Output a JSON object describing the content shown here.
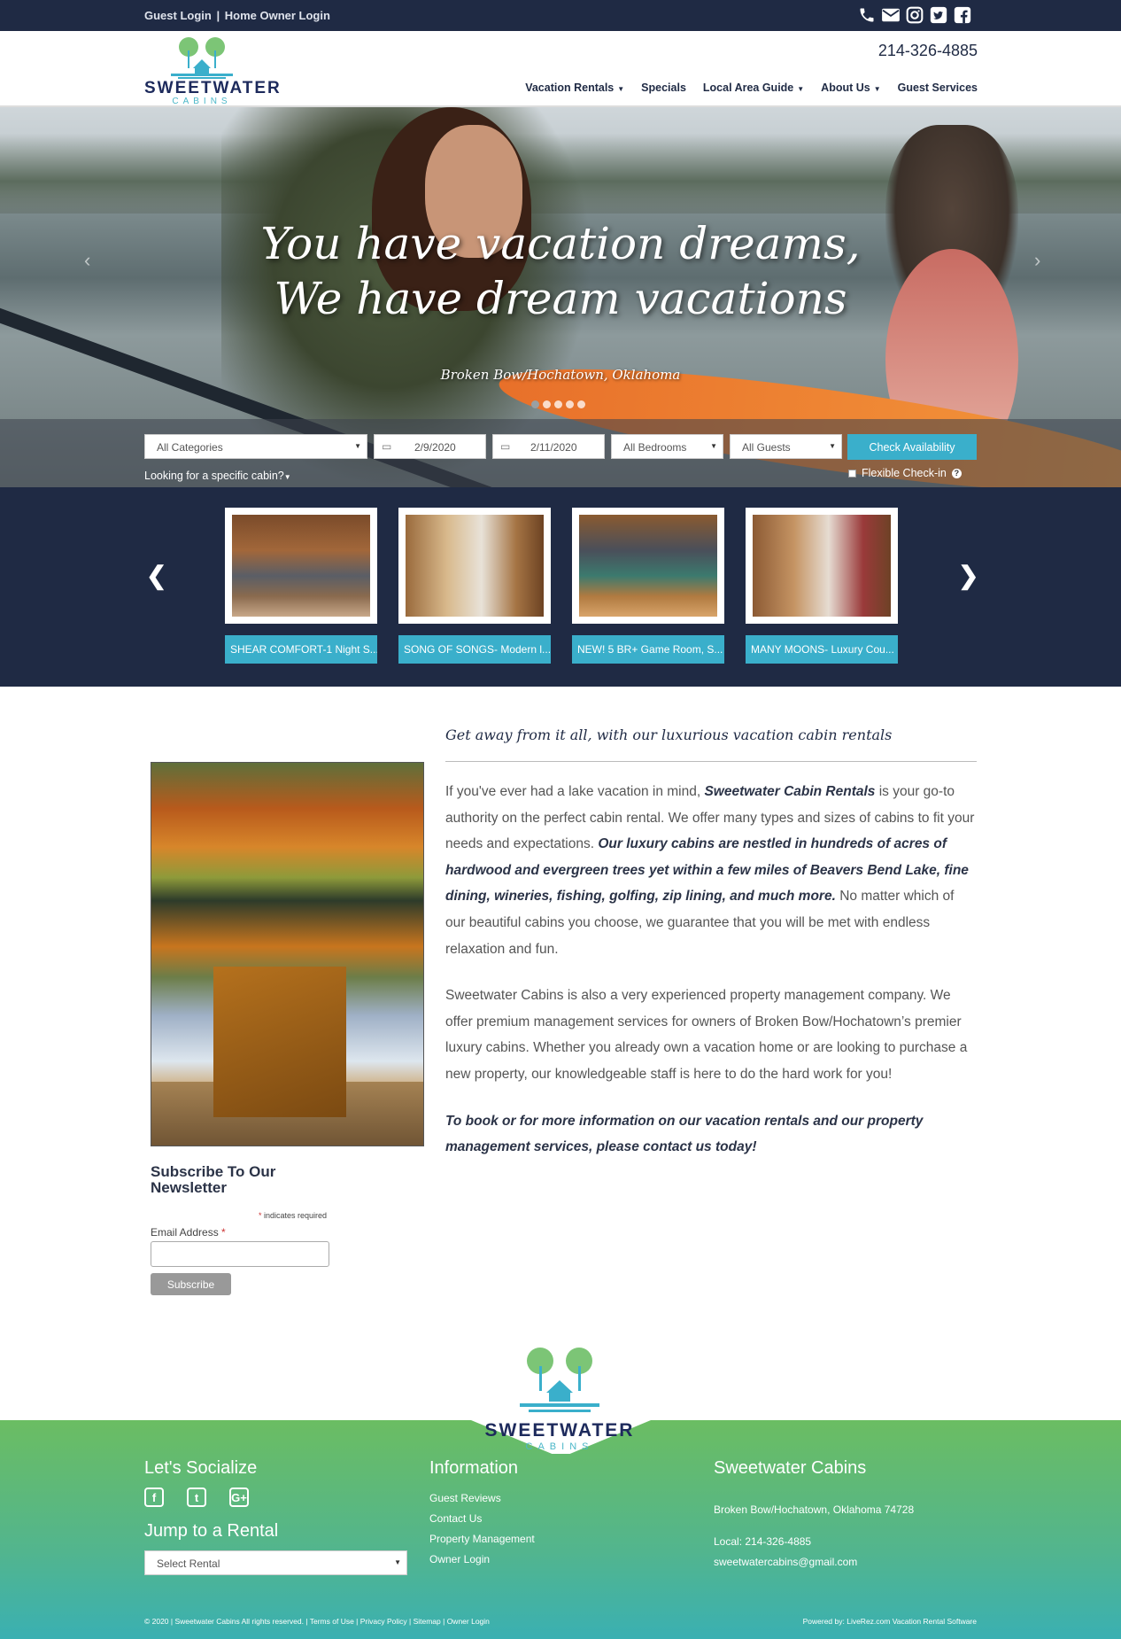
{
  "topbar": {
    "guest_login": "Guest Login",
    "separator": "|",
    "home_owner_login": "Home Owner Login",
    "icons": [
      "phone-icon",
      "envelope-icon",
      "instagram-icon",
      "twitter-icon",
      "facebook-icon"
    ]
  },
  "header": {
    "brand": "SWEETWATER",
    "brand_sub": "CABINS",
    "phone": "214-326-4885",
    "nav": [
      {
        "label": "Vacation Rentals",
        "dropdown": true
      },
      {
        "label": "Specials",
        "dropdown": false
      },
      {
        "label": "Local Area Guide",
        "dropdown": true
      },
      {
        "label": "About Us",
        "dropdown": true
      },
      {
        "label": "Guest Services",
        "dropdown": false
      }
    ]
  },
  "hero": {
    "title_line1": "You have vacation dreams,",
    "title_line2": "We have dream vacations",
    "subtitle": "Broken Bow/Hochatown, Oklahoma",
    "slide_count": 5,
    "active_slide": 0
  },
  "search": {
    "category": "All Categories",
    "arrival": "2/9/2020",
    "departure": "2/11/2020",
    "bedrooms": "All Bedrooms",
    "guests": "All Guests",
    "check_button": "Check Availability",
    "specific_link": "Looking for a specific cabin?",
    "flexible_label": "Flexible Check-in",
    "flexible_checked": false
  },
  "featured": [
    {
      "label": "SHEAR COMFORT-1 Night S..."
    },
    {
      "label": "SONG OF SONGS- Modern l..."
    },
    {
      "label": "NEW! 5 BR+ Game Room, S..."
    },
    {
      "label": "MANY MOONS- Luxury Cou..."
    }
  ],
  "content": {
    "tagline": "Get away from it all, with our luxurious vacation cabin rentals",
    "p1_a": "If you've ever had a lake vacation in mind, ",
    "p1_b": "Sweetwater Cabin Rentals",
    "p1_c": " is your go-to authority on the perfect cabin rental. We offer many types and sizes of cabins to fit your needs and expectations.  ",
    "p1_d": "Our luxury cabins are nestled in hundreds of acres of hardwood and evergreen trees yet within a few miles of Beavers Bend Lake, fine dining, wineries, fishing, golfing, zip lining, and much more.",
    "p1_e": " No matter which of our beautiful cabins you choose, we guarantee that you will be met with endless relaxation and fun.",
    "p2": "Sweetwater Cabins is also a very experienced property management company.  We offer premium management services for owners of Broken Bow/Hochatown’s premier luxury cabins. Whether you already own a vacation home or are looking to purchase a new property, our knowledgeable staff is here to do the hard work for you!",
    "p3": "To book or for more information on our vacation rentals and our property management services, please contact us today!"
  },
  "newsletter": {
    "title": "Subscribe To Our Newsletter",
    "required_star": "*",
    "required_note": " indicates required",
    "email_label": "Email Address ",
    "button": "Subscribe"
  },
  "footer": {
    "brand": "SWEETWATER",
    "brand_sub": "CABINS",
    "social_title": "Let's Socialize",
    "social_icons": [
      "facebook-icon",
      "twitter-icon",
      "google-plus-icon"
    ],
    "jump_title": "Jump to a Rental",
    "jump_placeholder": "Select Rental",
    "info_title": "Information",
    "info_links": [
      "Guest Reviews",
      "Contact Us",
      "Property Management",
      "Owner Login"
    ],
    "company_title": "Sweetwater Cabins",
    "address": "Broken Bow/Hochatown, Oklahoma 74728",
    "local_phone": "Local: 214-326-4885",
    "email": "sweetwatercabins@gmail.com",
    "copyright": "© 2020 | Sweetwater Cabins All rights reserved. | Terms of Use | Privacy Policy | Sitemap | Owner Login",
    "powered": "Powered by: LiveRez.com Vacation Rental Software"
  },
  "colors": {
    "navy": "#1f2a44",
    "teal": "#3aafcb",
    "green": "#6bbd62"
  }
}
